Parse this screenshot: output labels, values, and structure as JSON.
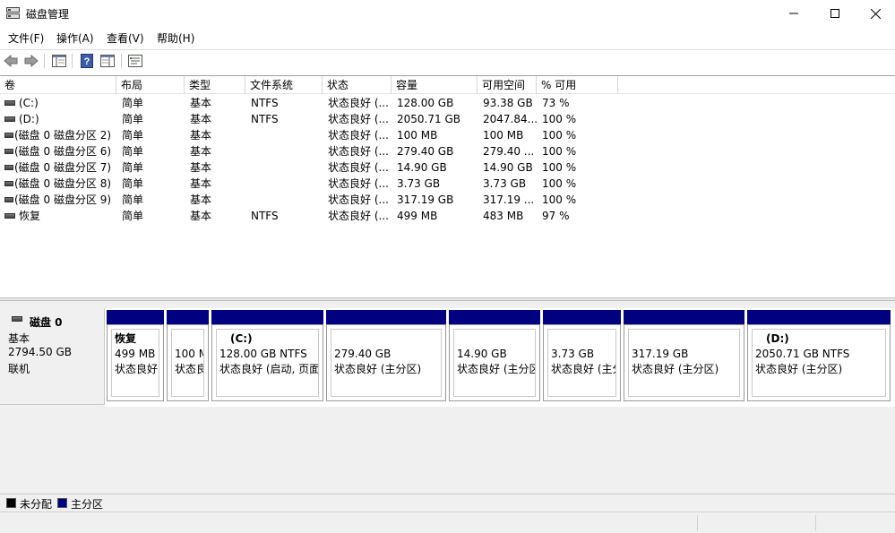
{
  "window": {
    "title": "磁盘管理"
  },
  "menu": [
    "文件(F)",
    "操作(A)",
    "查看(V)",
    "帮助(H)"
  ],
  "toolbar": {
    "icons": [
      "back-arrow-icon",
      "forward-arrow-icon",
      "console-tree-icon",
      "help-icon",
      "properties-icon",
      "settings-icon"
    ]
  },
  "volume_list": {
    "columns": [
      "卷",
      "布局",
      "类型",
      "文件系统",
      "状态",
      "容量",
      "可用空间",
      "% 可用"
    ],
    "rows": [
      {
        "volume": "(C:)",
        "layout": "简单",
        "type": "基本",
        "fs": "NTFS",
        "status": "状态良好 (...",
        "capacity": "128.00 GB",
        "free": "93.38 GB",
        "pct": "73 %"
      },
      {
        "volume": "(D:)",
        "layout": "简单",
        "type": "基本",
        "fs": "NTFS",
        "status": "状态良好 (...",
        "capacity": "2050.71 GB",
        "free": "2047.84...",
        "pct": "100 %"
      },
      {
        "volume": "(磁盘 0 磁盘分区 2)",
        "layout": "简单",
        "type": "基本",
        "fs": "",
        "status": "状态良好 (...",
        "capacity": "100 MB",
        "free": "100 MB",
        "pct": "100 %"
      },
      {
        "volume": "(磁盘 0 磁盘分区 6)",
        "layout": "简单",
        "type": "基本",
        "fs": "",
        "status": "状态良好 (...",
        "capacity": "279.40 GB",
        "free": "279.40 ...",
        "pct": "100 %"
      },
      {
        "volume": "(磁盘 0 磁盘分区 7)",
        "layout": "简单",
        "type": "基本",
        "fs": "",
        "status": "状态良好 (...",
        "capacity": "14.90 GB",
        "free": "14.90 GB",
        "pct": "100 %"
      },
      {
        "volume": "(磁盘 0 磁盘分区 8)",
        "layout": "简单",
        "type": "基本",
        "fs": "",
        "status": "状态良好 (...",
        "capacity": "3.73 GB",
        "free": "3.73 GB",
        "pct": "100 %"
      },
      {
        "volume": "(磁盘 0 磁盘分区 9)",
        "layout": "简单",
        "type": "基本",
        "fs": "",
        "status": "状态良好 (...",
        "capacity": "317.19 GB",
        "free": "317.19 ...",
        "pct": "100 %"
      },
      {
        "volume": "恢复",
        "layout": "简单",
        "type": "基本",
        "fs": "NTFS",
        "status": "状态良好 (...",
        "capacity": "499 MB",
        "free": "483 MB",
        "pct": "97 %"
      }
    ]
  },
  "disk": {
    "name": "磁盘 0",
    "type": "基本",
    "size": "2794.50 GB",
    "state": "联机",
    "partitions": [
      {
        "name": "恢复",
        "size": "499 MB I",
        "status": "状态良好"
      },
      {
        "name": "",
        "size": "100 M",
        "status": "状态良"
      },
      {
        "name": "(C:)",
        "size": "128.00 GB NTFS",
        "status": "状态良好 (启动, 页面"
      },
      {
        "name": "",
        "size": "279.40 GB",
        "status": "状态良好 (主分区)"
      },
      {
        "name": "",
        "size": "14.90 GB",
        "status": "状态良好 (主分区"
      },
      {
        "name": "",
        "size": "3.73 GB",
        "status": "状态良好 (主分"
      },
      {
        "name": "",
        "size": "317.19 GB",
        "status": "状态良好 (主分区)"
      },
      {
        "name": "(D:)",
        "size": "2050.71 GB NTFS",
        "status": "状态良好 (主分区)"
      }
    ]
  },
  "legend": [
    {
      "label": "未分配",
      "color": "#000000"
    },
    {
      "label": "主分区",
      "color": "#000080"
    }
  ],
  "colors": {
    "partition_bar": "#000080",
    "window_bg": "#f0f0f0"
  }
}
